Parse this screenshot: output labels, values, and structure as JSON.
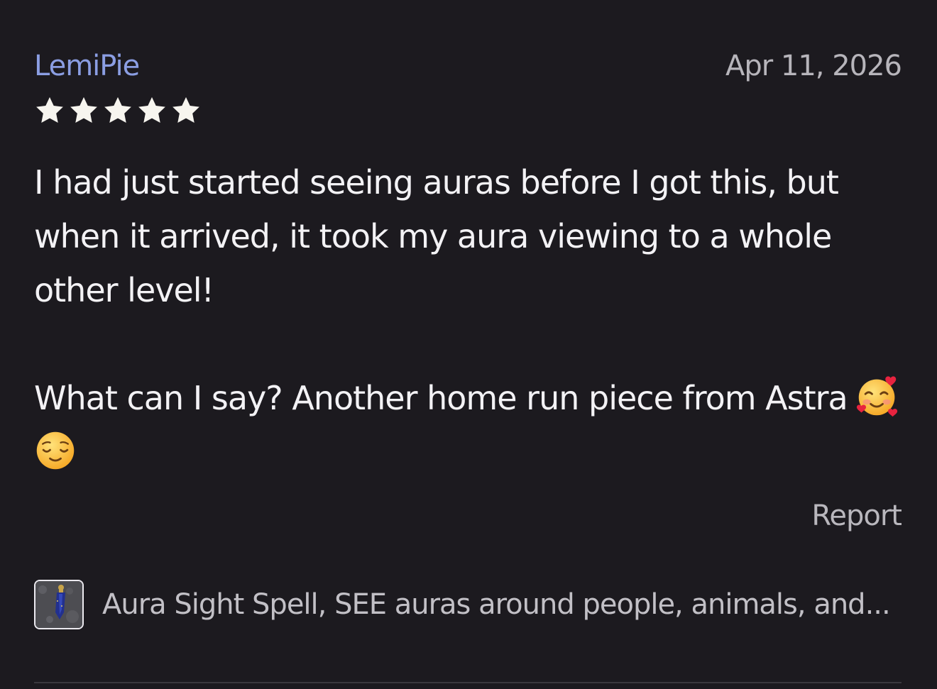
{
  "review": {
    "reviewer_name": "LemiPie",
    "date": "Apr 11, 2026",
    "rating": 5,
    "rating_max": 5,
    "paragraph_1": "I had just started seeing auras before I got this, but when it arrived, it took my aura viewing to a whole other level!",
    "paragraph_2": "What can I say? Another home run piece from Astra",
    "emojis": [
      "smiling-face-with-hearts-emoji",
      "relieved-face-emoji"
    ],
    "report_label": "Report",
    "listing_title": "Aura Sight Spell, SEE auras around people, animals, and...",
    "listing_thumbnail": "lapis-pendant-thumbnail"
  },
  "colors": {
    "background": "#1c1a1f",
    "reviewer_name": "#8b9ee3",
    "body_text": "#f3f2f5",
    "muted_text": "#b9b7bd",
    "star": "#f7f5ef",
    "divider": "#3a383e"
  }
}
